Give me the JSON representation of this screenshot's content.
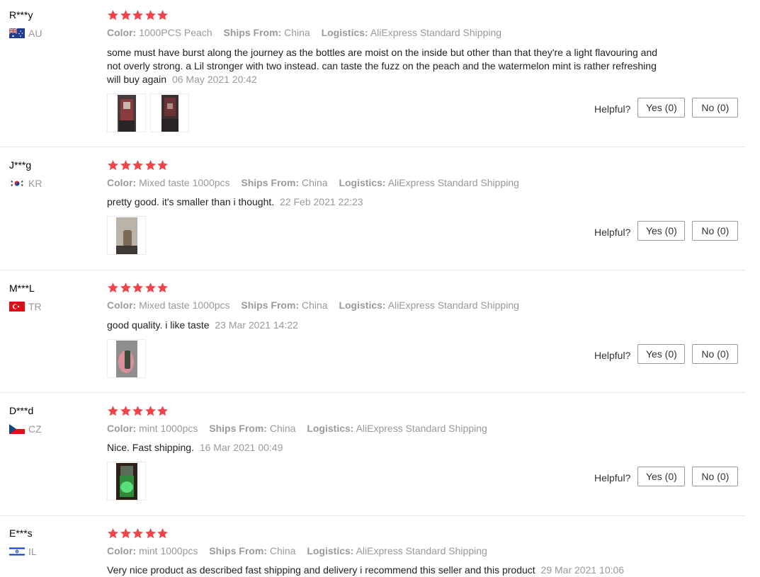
{
  "labels": {
    "color": "Color:",
    "ships_from": "Ships From:",
    "logistics": "Logistics:",
    "helpful": "Helpful?",
    "yes": "Yes (0)",
    "no": "No (0)"
  },
  "colors": {
    "star": "#f0444a",
    "text": "#333333",
    "muted": "#999999"
  },
  "reviews": [
    {
      "buyer": "R***y",
      "country": "AU",
      "flag_icon": "flag-au-icon",
      "stars": 5,
      "color": "1000PCS Peach",
      "ships_from": "China",
      "logistics": "AliExpress Standard Shipping",
      "text": "some must have burst along the journey as the bottles are moist on the inside but other than that they're a light flavouring and not overly strong. a Lil stronger with two instead. can taste the fuzz on the peach and the watermelon mint is rather refreshing will buy again",
      "date": "06 May 2021 20:42",
      "photos": 2
    },
    {
      "buyer": "J***g",
      "country": "KR",
      "flag_icon": "flag-kr-icon",
      "stars": 5,
      "color": "Mixed taste 1000pcs",
      "ships_from": "China",
      "logistics": "AliExpress Standard Shipping",
      "text": "pretty good. it's smaller than i thought.",
      "date": "22 Feb 2021 22:23",
      "photos": 1
    },
    {
      "buyer": "M***L",
      "country": "TR",
      "flag_icon": "flag-tr-icon",
      "stars": 5,
      "color": "Mixed taste 1000pcs",
      "ships_from": "China",
      "logistics": "AliExpress Standard Shipping",
      "text": "good quality. i like taste",
      "date": "23 Mar 2021 14:22",
      "photos": 1
    },
    {
      "buyer": "D***d",
      "country": "CZ",
      "flag_icon": "flag-cz-icon",
      "stars": 5,
      "color": "mint 1000pcs",
      "ships_from": "China",
      "logistics": "AliExpress Standard Shipping",
      "text": "Nice. Fast shipping.",
      "date": "16 Mar 2021 00:49",
      "photos": 1
    },
    {
      "buyer": "E***s",
      "country": "IL",
      "flag_icon": "flag-il-icon",
      "stars": 5,
      "color": "mint 1000pcs",
      "ships_from": "China",
      "logistics": "AliExpress Standard Shipping",
      "text": "Very nice product as described fast shipping and delivery i recommend this seller and this product",
      "date": "29 Mar 2021 10:06",
      "photos": 0
    }
  ]
}
